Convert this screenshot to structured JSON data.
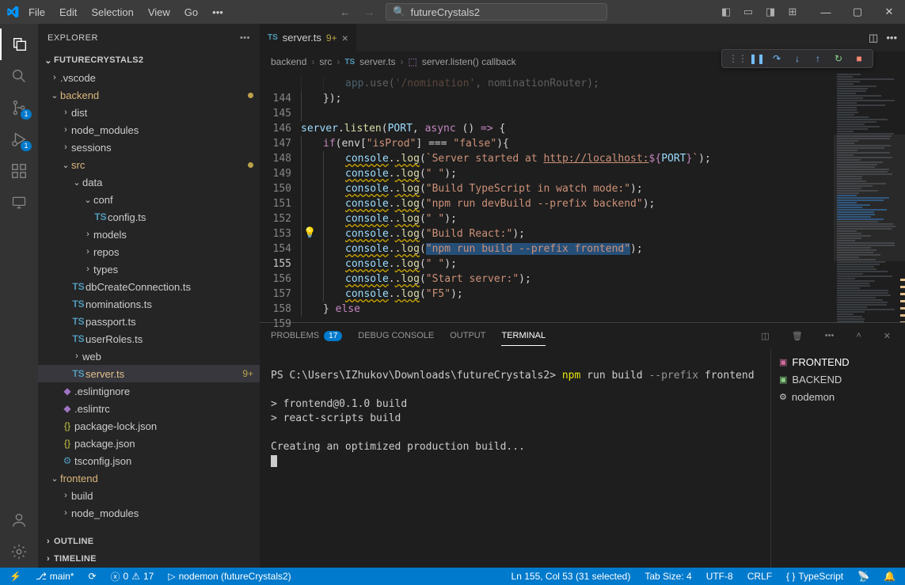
{
  "title_search": "futureCrystals2",
  "menu": [
    "File",
    "Edit",
    "Selection",
    "View",
    "Go"
  ],
  "activity_badges": {
    "scm": "1",
    "debug": "1"
  },
  "sidebar": {
    "title": "EXPLORER",
    "root": "FUTURECRYSTALS2",
    "outline": "OUTLINE",
    "timeline": "TIMELINE"
  },
  "tree": {
    "vscode": ".vscode",
    "backend": "backend",
    "dist": "dist",
    "node_modules": "node_modules",
    "sessions": "sessions",
    "src": "src",
    "data": "data",
    "conf": "conf",
    "config_ts": "config.ts",
    "models": "models",
    "repos": "repos",
    "types": "types",
    "dbCreate": "dbCreateConnection.ts",
    "nominations": "nominations.ts",
    "passport": "passport.ts",
    "userRoles": "userRoles.ts",
    "web": "web",
    "server_ts": "server.ts",
    "server_mod": "9+",
    "eslintignore": ".eslintignore",
    "eslintrc": ".eslintrc",
    "pkglock": "package-lock.json",
    "pkg": "package.json",
    "tsconfig": "tsconfig.json",
    "frontend": "frontend",
    "build": "build",
    "node_modules2": "node_modules"
  },
  "tab": {
    "label": "server.ts",
    "mod": "9+"
  },
  "breadcrumb": {
    "p1": "backend",
    "p2": "src",
    "p3": "server.ts",
    "p4": "server.listen() callback"
  },
  "gutter_start": 144,
  "gutter_end": 159,
  "code": {
    "l144_a": "app",
    ".l144_b": ".use(",
    "l144_c": "'/nomination'",
    "l144_d": ", nominationRouter);",
    "l145": "});",
    "l147_a": "server",
    "l147_b": ".listen(",
    "l147_c": "PORT",
    "l147_d": ", ",
    "l147_e": "async",
    "l147_f": " () ",
    "l147_g": "=>",
    "l147_h": " {",
    "l148_a": "if",
    "l148_b": "(env[",
    "l148_c": "\"isProd\"",
    "l148_d": "] ",
    "l148_e": "===",
    "l148_f": " ",
    "l148_g": "\"false\"",
    "l148_h": "){",
    "l149_a": "console",
    "l149_b": ".log",
    "l149_c": "(",
    "l149_d": "`Server started at ",
    "l149_e": "http://localhost:",
    "l149_f": "${",
    "l149_g": "PORT",
    "l149_h": "}",
    "l149_i": "`",
    "l149_j": ");",
    "l150_a": "console",
    "l150_b": ".log",
    "l150_c": "(",
    "l150_d": "\" \"",
    "l150_e": ");",
    "l151_a": "console",
    "l151_b": ".log",
    "l151_c": "(",
    "l151_d": "\"Build TypeScript in watch mode:\"",
    "l151_e": ");",
    "l152_a": "console",
    "l152_b": ".log",
    "l152_c": "(",
    "l152_d": "\"npm run devBuild --prefix backend\"",
    "l152_e": ");",
    "l153_a": "console",
    "l153_b": ".log",
    "l153_c": "(",
    "l153_d": "\" \"",
    "l153_e": ");",
    "l154_a": "console",
    "l154_b": ".log",
    "l154_c": "(",
    "l154_d": "\"Build React:\"",
    "l154_e": ");",
    "l155_a": "console",
    "l155_b": ".log",
    "l155_c": "(",
    "l155_d": "\"npm run build --prefix frontend\"",
    "l155_e": ");",
    "l156_a": "console",
    "l156_b": ".log",
    "l156_c": "(",
    "l156_d": "\" \"",
    "l156_e": ");",
    "l157_a": "console",
    "l157_b": ".log",
    "l157_c": "(",
    "l157_d": "\"Start server:\"",
    "l157_e": ");",
    "l158_a": "console",
    "l158_b": ".log",
    "l158_c": "(",
    "l158_d": "\"F5\"",
    "l158_e": ");",
    "l159_a": "} ",
    "l159_b": "else"
  },
  "panel": {
    "problems": "PROBLEMS",
    "problems_n": "17",
    "debug": "DEBUG CONSOLE",
    "output": "OUTPUT",
    "terminal": "TERMINAL"
  },
  "term": {
    "ps": "PS C:\\Users\\IZhukov\\Downloads\\futureCrystals2> ",
    "cmd_a": "npm ",
    "cmd_b": "run build ",
    "cmd_c": "--prefix ",
    "cmd_d": "frontend",
    "l2": "> frontend@0.1.0 build",
    "l3": "> react-scripts build",
    "l4": "Creating an optimized production build..."
  },
  "termlist": {
    "t1": "FRONTEND",
    "t2": "BACKEND",
    "t3": "nodemon"
  },
  "status": {
    "branch": "main*",
    "sync": "",
    "err": "0",
    "warn": "17",
    "debug": "nodemon (futureCrystals2)",
    "pos": "Ln 155, Col 53 (31 selected)",
    "tab": "Tab Size: 4",
    "enc": "UTF-8",
    "eol": "CRLF",
    "lang": "TypeScript"
  }
}
